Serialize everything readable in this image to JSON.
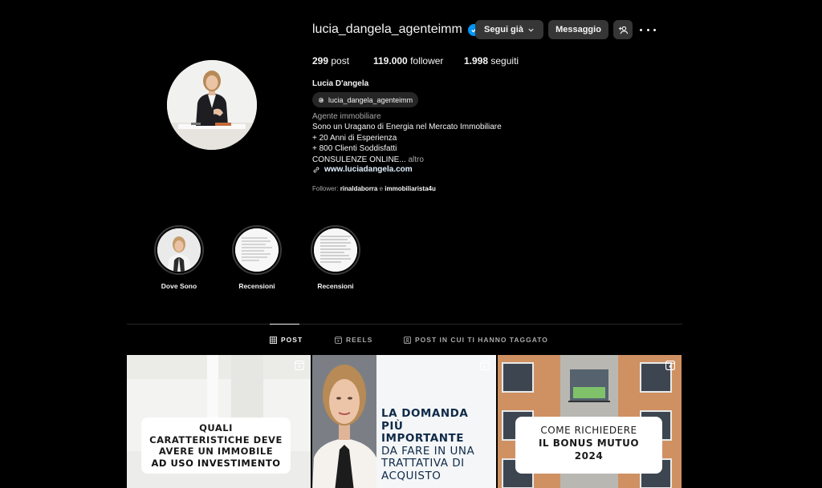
{
  "profile": {
    "username": "lucia_dangela_agenteimm",
    "follow_button": "Segui già",
    "message_button": "Messaggio",
    "stats": {
      "posts_count": "299",
      "posts_label": "post",
      "followers_count": "119.000",
      "followers_label": "follower",
      "following_count": "1.998",
      "following_label": "seguiti"
    },
    "full_name": "Lucia D'angela",
    "threads_handle": "lucia_dangela_agenteimm",
    "category": "Agente immobiliare",
    "bio_lines": [
      "Sono un Uragano di Energia nel Mercato Immobiliare",
      "+ 20 Anni di Esperienza",
      "+ 800 Clienti Soddisfatti",
      "CONSULENZE ONLINE..."
    ],
    "more_label": "altro",
    "website": "www.luciadangela.com",
    "followed_by_prefix": "Follower:",
    "followed_by_1": "rinaldaborra",
    "followed_by_conj": "e",
    "followed_by_2": "immobiliarista4u"
  },
  "highlights": [
    {
      "label": "Dove Sono"
    },
    {
      "label": "Recensioni"
    },
    {
      "label": "Recensioni"
    }
  ],
  "tabs": [
    {
      "label": "POST",
      "active": true
    },
    {
      "label": "REELS",
      "active": false
    },
    {
      "label": "POST IN CUI TI HANNO TAGGATO",
      "active": false
    }
  ],
  "posts": [
    {
      "lines": [
        "QUALI",
        "CARATTERISTICHE DEVE",
        "AVERE UN IMMOBILE",
        "AD USO INVESTIMENTO"
      ]
    },
    {
      "lines": [
        "LA DOMANDA",
        "PIÙ",
        "IMPORTANTE",
        "DA FARE IN UNA",
        "TRATTATIVA DI",
        "ACQUISTO"
      ]
    },
    {
      "lines": [
        "COME RICHIEDERE",
        "IL BONUS MUTUO",
        "2024"
      ]
    }
  ],
  "colors": {
    "background": "#000000",
    "button": "#363636",
    "verified": "#0095f6",
    "muted_text": "#a8a8a8",
    "link_text": "#e0f1ff"
  }
}
